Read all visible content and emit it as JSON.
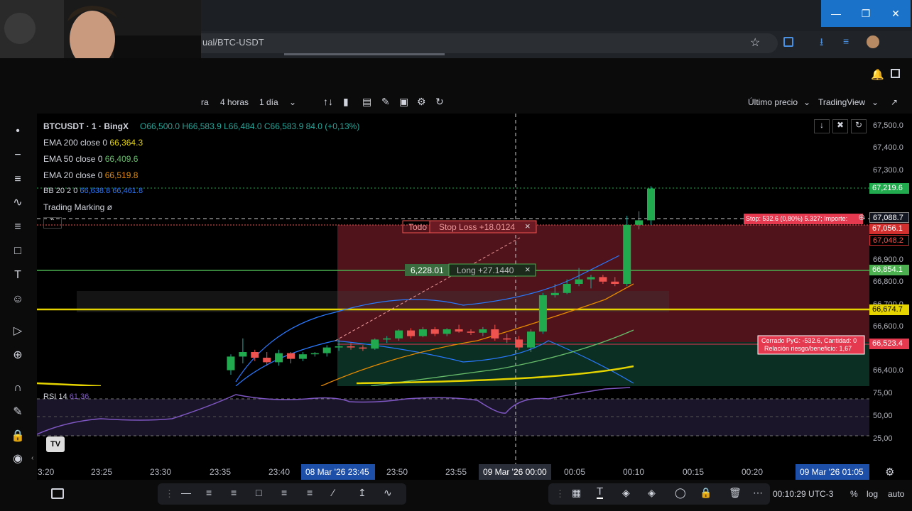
{
  "browser": {
    "url_visible": "ual/BTC-USDT",
    "window_controls": [
      "minimize",
      "restore",
      "close"
    ]
  },
  "toolbar": {
    "timeframe_partial": "ra",
    "timeframe_4h": "4 horas",
    "timeframe_1d": "1 día",
    "price_source": "Último precio",
    "platform": "TradingView"
  },
  "legend": {
    "symbol": "BTCUSDT · 1 · BingX",
    "ohlc_o": "O66,500.0",
    "ohlc_h": "H66,583.9",
    "ohlc_l": "L66,484.0",
    "ohlc_c": "C66,583.9",
    "change": "84.0 (+0,13%)",
    "ema200_label": "EMA 200 close 0",
    "ema200_value": "66,364.3",
    "ema50_label": "EMA 50 close 0",
    "ema50_value": "66,409.6",
    "ema20_label": "EMA 20 close 0",
    "ema20_value": "66,519.8",
    "bb_label": "BB 20 2 0",
    "bb_v1": "66,638.8",
    "bb_v2": "66,461.8",
    "trading_marking": "Trading Marking",
    "trading_marking_icon": "ø",
    "rsi_label": "RSI 14",
    "rsi_value": "61,36"
  },
  "position": {
    "todo_label": "Todo",
    "stop_loss_label": "Stop Loss +18.0124",
    "long_qty": "6,228.01",
    "long_label": "Long +27.1440",
    "stop_banner": "Stop: 532.6 (0,80%) 5.327; Importe:",
    "closed_line1": "Cerrado PyG: -532.6, Cantidad: 0",
    "closed_line2": "Relación riesgo/beneficio: 1,67"
  },
  "price_axis": {
    "labels": [
      "67,500.0",
      "67,400.0",
      "67,300.0",
      "66,900.0",
      "66,800.0",
      "66,700.0",
      "66,600.0",
      "66,400.0"
    ],
    "tags": [
      {
        "value": "67,219.6",
        "color": "#22ab4e"
      },
      {
        "value": "67,088.7",
        "color": "#131722"
      },
      {
        "value": "67,056.1",
        "color": "#d32f2f"
      },
      {
        "value": "67,048.2",
        "color": "#000000"
      },
      {
        "value": "66,854.1",
        "color": "#4caf50"
      },
      {
        "value": "66,674.7",
        "color": "#e6d400"
      },
      {
        "value": "66,523.4",
        "color": "#e53950"
      }
    ],
    "rsi_labels": [
      "75,00",
      "50,00",
      "25,00"
    ]
  },
  "time_axis": {
    "labels": [
      "3:20",
      "23:25",
      "23:30",
      "23:35",
      "23:40",
      "23:50",
      "23:55",
      "00:05",
      "00:10",
      "00:15",
      "00:20"
    ],
    "highlight_left": "08 Mar '26  23:45",
    "crosshair_time": "09 Mar '26  00:00",
    "highlight_right": "09 Mar '26  01:05"
  },
  "bottom": {
    "clock": "00:10:29 UTC-3",
    "percent": "%",
    "log": "log",
    "auto": "auto"
  },
  "chart_data": {
    "type": "candlestick",
    "y_range": [
      66350,
      67550
    ],
    "candles": [
      {
        "o": 66420,
        "h": 66490,
        "l": 66400,
        "c": 66480
      },
      {
        "o": 66480,
        "h": 66560,
        "l": 66450,
        "c": 66500
      },
      {
        "o": 66500,
        "h": 66510,
        "l": 66460,
        "c": 66475
      },
      {
        "o": 66475,
        "h": 66500,
        "l": 66440,
        "c": 66455
      },
      {
        "o": 66455,
        "h": 66510,
        "l": 66440,
        "c": 66495
      },
      {
        "o": 66495,
        "h": 66500,
        "l": 66450,
        "c": 66470
      },
      {
        "o": 66470,
        "h": 66500,
        "l": 66460,
        "c": 66490
      },
      {
        "o": 66490,
        "h": 66500,
        "l": 66480,
        "c": 66495
      },
      {
        "o": 66495,
        "h": 66530,
        "l": 66480,
        "c": 66520
      },
      {
        "o": 66520,
        "h": 66560,
        "l": 66505,
        "c": 66525
      },
      {
        "o": 66525,
        "h": 66540,
        "l": 66510,
        "c": 66520
      },
      {
        "o": 66520,
        "h": 66530,
        "l": 66505,
        "c": 66515
      },
      {
        "o": 66515,
        "h": 66560,
        "l": 66510,
        "c": 66555
      },
      {
        "o": 66555,
        "h": 66570,
        "l": 66540,
        "c": 66560
      },
      {
        "o": 66560,
        "h": 66600,
        "l": 66550,
        "c": 66595
      },
      {
        "o": 66595,
        "h": 66605,
        "l": 66560,
        "c": 66570
      },
      {
        "o": 66570,
        "h": 66610,
        "l": 66565,
        "c": 66600
      },
      {
        "o": 66600,
        "h": 66610,
        "l": 66570,
        "c": 66580
      },
      {
        "o": 66580,
        "h": 66605,
        "l": 66570,
        "c": 66600
      },
      {
        "o": 66600,
        "h": 66620,
        "l": 66585,
        "c": 66590
      },
      {
        "o": 66590,
        "h": 66600,
        "l": 66575,
        "c": 66585
      },
      {
        "o": 66585,
        "h": 66610,
        "l": 66570,
        "c": 66600
      },
      {
        "o": 66600,
        "h": 66620,
        "l": 66550,
        "c": 66560
      },
      {
        "o": 66560,
        "h": 66580,
        "l": 66540,
        "c": 66555
      },
      {
        "o": 66555,
        "h": 66570,
        "l": 66510,
        "c": 66520
      },
      {
        "o": 66520,
        "h": 66600,
        "l": 66500,
        "c": 66590
      },
      {
        "o": 66590,
        "h": 66760,
        "l": 66580,
        "c": 66750
      },
      {
        "o": 66750,
        "h": 66800,
        "l": 66740,
        "c": 66760
      },
      {
        "o": 66760,
        "h": 66820,
        "l": 66755,
        "c": 66800
      },
      {
        "o": 66800,
        "h": 66870,
        "l": 66790,
        "c": 66820
      },
      {
        "o": 66820,
        "h": 66840,
        "l": 66780,
        "c": 66830
      },
      {
        "o": 66830,
        "h": 66840,
        "l": 66800,
        "c": 66810
      },
      {
        "o": 66810,
        "h": 66830,
        "l": 66790,
        "c": 66800
      },
      {
        "o": 66800,
        "h": 67100,
        "l": 66790,
        "c": 67060
      },
      {
        "o": 67060,
        "h": 67120,
        "l": 67040,
        "c": 67080
      },
      {
        "o": 67080,
        "h": 67230,
        "l": 67060,
        "c": 67220
      }
    ]
  }
}
